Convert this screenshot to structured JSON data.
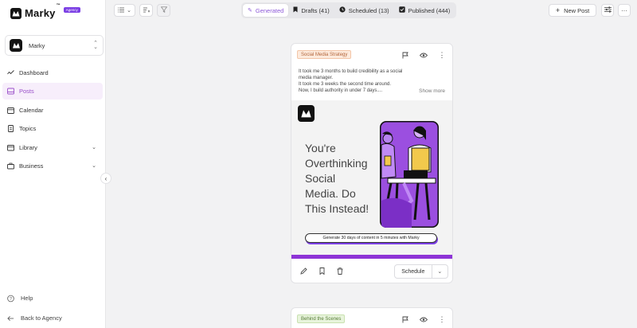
{
  "brand": {
    "name": "Marky",
    "tm": "™",
    "badge": "Agency"
  },
  "workspace": {
    "name": "Marky"
  },
  "nav": {
    "items": [
      {
        "label": "Dashboard",
        "icon": "activity-icon"
      },
      {
        "label": "Posts",
        "icon": "posts-icon",
        "active": true
      },
      {
        "label": "Calendar",
        "icon": "calendar-icon"
      },
      {
        "label": "Topics",
        "icon": "document-icon"
      },
      {
        "label": "Library",
        "icon": "library-icon",
        "expandable": true
      },
      {
        "label": "Business",
        "icon": "briefcase-icon",
        "expandable": true
      }
    ],
    "help": "Help",
    "back": "Back to Agency"
  },
  "toolbar": {
    "tabs": [
      {
        "label": "Generated",
        "count": "",
        "active": true
      },
      {
        "label": "Drafts",
        "count": "(41)"
      },
      {
        "label": "Scheduled",
        "count": "(13)"
      },
      {
        "label": "Published",
        "count": "(444)"
      }
    ],
    "new_post": "New Post"
  },
  "post": {
    "tag": "Social Media Strategy",
    "caption_lines": [
      "It took me 3 months to build credibility as a social",
      "media manager.",
      "It took me 3 weeks the second time around.",
      "Now, I build authority in under 7 days...."
    ],
    "show_more": "Show more",
    "creative": {
      "headline_lines": [
        "You're",
        "Overthinking",
        "Social",
        "Media. Do",
        "This Instead!"
      ],
      "cta": "Generate 30 days of content in 5 minutes with Marky"
    },
    "schedule_label": "Schedule"
  },
  "post2": {
    "tag": "Behind the Scenes"
  },
  "colors": {
    "accent": "#8e34d6",
    "active_bg": "#f7eefb",
    "active_text": "#9a4fc9"
  }
}
